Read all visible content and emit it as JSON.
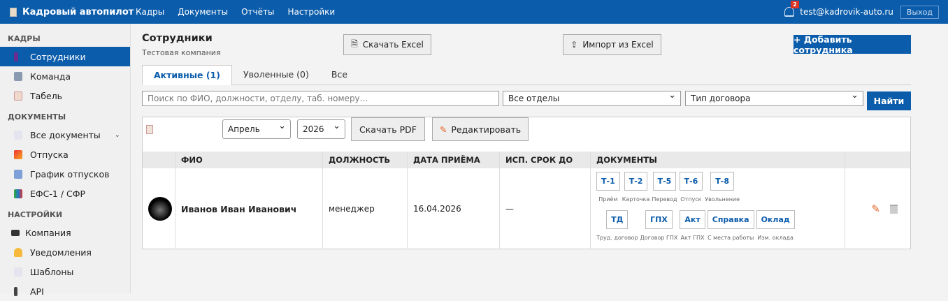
{
  "header": {
    "brand": "Кадровый автопилот",
    "nav": [
      "Кадры",
      "Документы",
      "Отчёты",
      "Настройки"
    ],
    "notifications": "2",
    "email": "test@kadrovik-auto.ru",
    "logout": "Выход"
  },
  "sidebar": {
    "sections": [
      {
        "title": "КАДРЫ",
        "items": [
          "Сотрудники",
          "Команда",
          "Табель"
        ]
      },
      {
        "title": "ДОКУМЕНТЫ",
        "items": [
          "Все документы",
          "Отпуска",
          "График отпусков",
          "ЕФС-1 / СФР"
        ]
      },
      {
        "title": "НАСТРОЙКИ",
        "items": [
          "Компания",
          "Уведомления",
          "Шаблоны",
          "API"
        ]
      }
    ]
  },
  "page": {
    "title": "Сотрудники",
    "company": "Тестовая компания",
    "download_excel": "Скачать Excel",
    "import_excel": "Импорт из Excel",
    "add_employee": "+ Добавить сотрудника"
  },
  "tabs": [
    "Активные (1)",
    "Уволенные (0)",
    "Все"
  ],
  "filters": {
    "search_placeholder": "Поиск по ФИО, должности, отделу, таб. номеру...",
    "department": "Все отделы",
    "contract_type": "Тип договора",
    "find": "Найти"
  },
  "toolbar": {
    "month": "Апрель",
    "year": "2026",
    "download_pdf": "Скачать PDF",
    "edit": "Редактировать"
  },
  "table": {
    "columns": [
      "ФИО",
      "ДОЛЖНОСТЬ",
      "ДАТА ПРИЁМА",
      "ИСП. СРОК ДО",
      "ДОКУМЕНТЫ"
    ],
    "rows": [
      {
        "name": "Иванов Иван Иванович",
        "position": "менеджер",
        "hire_date": "16.04.2026",
        "probation": "—",
        "docs_row1": [
          {
            "code": "Т-1",
            "label": "Приём"
          },
          {
            "code": "Т-2",
            "label": "Карточка"
          },
          {
            "code": "Т-5",
            "label": "Перевод"
          },
          {
            "code": "Т-6",
            "label": "Отпуск"
          },
          {
            "code": "Т-8",
            "label": "Увольнение"
          }
        ],
        "docs_row2": [
          {
            "code": "ТД",
            "label": "Труд. договор"
          },
          {
            "code": "ГПХ",
            "label": "Договор ГПХ"
          },
          {
            "code": "Акт",
            "label": "Акт ГПХ"
          },
          {
            "code": "Справка",
            "label": "С места работы"
          },
          {
            "code": "Оклад",
            "label": "Изм. оклада"
          }
        ]
      }
    ]
  }
}
